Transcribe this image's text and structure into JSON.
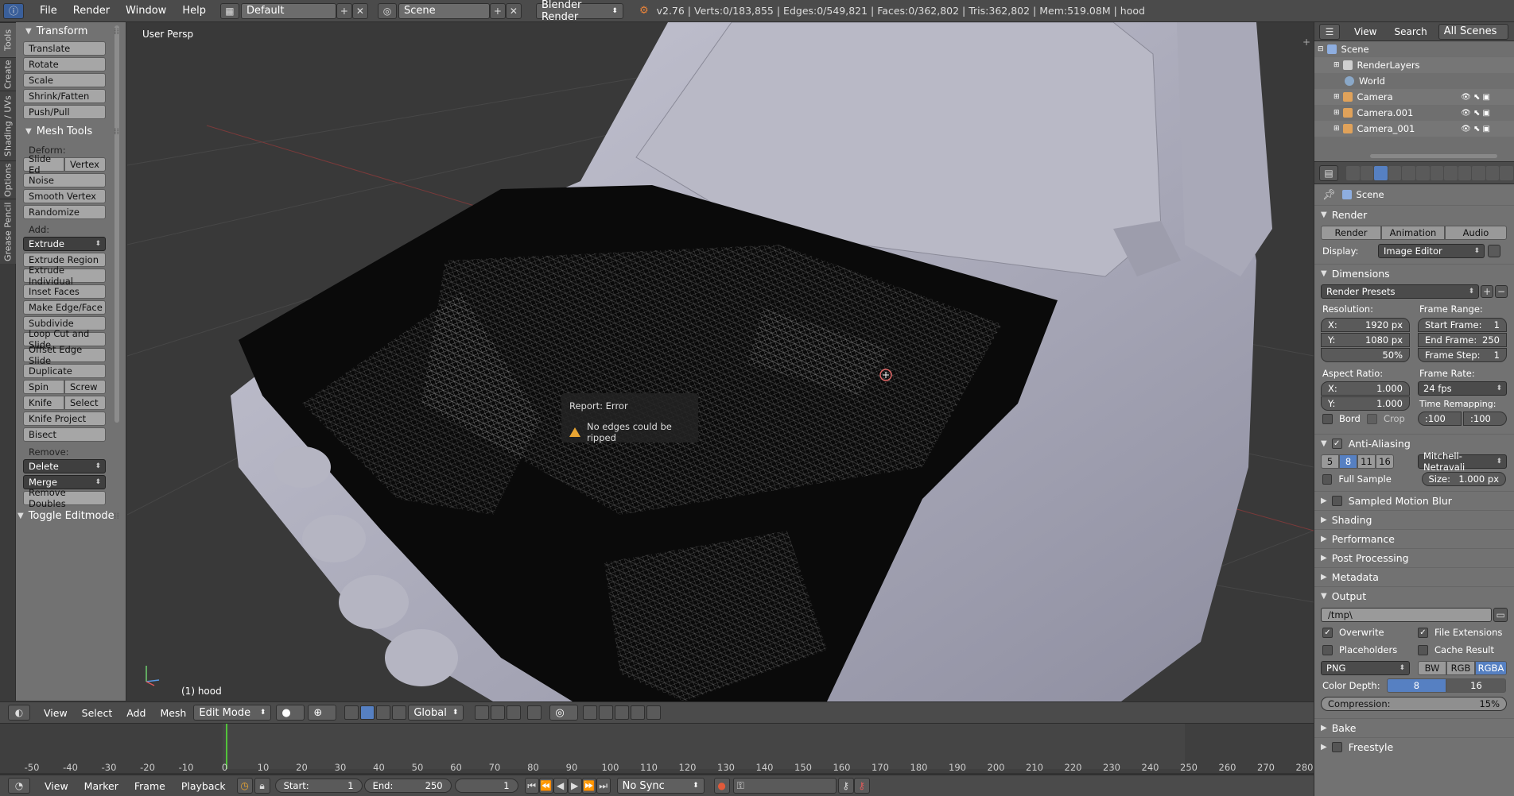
{
  "topbar": {
    "menus": [
      "File",
      "Render",
      "Window",
      "Help"
    ],
    "layout": "Default",
    "scene": "Scene",
    "engine": "Blender Render",
    "stats": "v2.76 | Verts:0/183,855 | Edges:0/549,821 | Faces:0/362,802 | Tris:362,802 | Mem:519.08M | hood"
  },
  "left_tabs": [
    "Tools",
    "Create",
    "Shading / UVs",
    "Options",
    "Grease Pencil"
  ],
  "toolshelf": {
    "transform_title": "Transform",
    "transform": [
      "Translate",
      "Rotate",
      "Scale",
      "Shrink/Fatten",
      "Push/Pull"
    ],
    "mesh_tools_title": "Mesh Tools",
    "deform_label": "Deform:",
    "slide_edge": "Slide Ed",
    "vertex": "Vertex",
    "deform": [
      "Noise",
      "Smooth Vertex",
      "Randomize"
    ],
    "add_label": "Add:",
    "extrude": "Extrude",
    "add": [
      "Extrude Region",
      "Extrude Individual",
      "Inset Faces",
      "Make Edge/Face",
      "Subdivide",
      "Loop Cut and Slide",
      "Offset Edge Slide",
      "Duplicate"
    ],
    "spin": "Spin",
    "screw": "Screw",
    "knife": "Knife",
    "select": "Select",
    "knife_project": "Knife Project",
    "bisect": "Bisect",
    "remove_label": "Remove:",
    "delete": "Delete",
    "merge": "Merge",
    "remove_doubles": "Remove Doubles",
    "toggle_editmode": "Toggle Editmode"
  },
  "viewport": {
    "view_label": "User Persp",
    "object_label": "(1) hood",
    "report_title": "Report: Error",
    "report_msg": "No edges could be ripped"
  },
  "vpheader": {
    "menus": [
      "View",
      "Select",
      "Add",
      "Mesh"
    ],
    "mode": "Edit Mode",
    "orientation": "Global"
  },
  "timeline": {
    "ticks": [
      -50,
      -40,
      -30,
      -20,
      -10,
      0,
      10,
      20,
      30,
      40,
      50,
      60,
      70,
      80,
      90,
      100,
      110,
      120,
      130,
      140,
      150,
      160,
      170,
      180,
      190,
      200,
      210,
      220,
      230,
      240,
      250,
      260,
      270,
      280
    ],
    "current_frame": 1
  },
  "bottombar": {
    "menus": [
      "View",
      "Marker",
      "Frame",
      "Playback"
    ],
    "start_label": "Start:",
    "start": "1",
    "end_label": "End:",
    "end": "250",
    "frame": "1",
    "sync": "No Sync"
  },
  "outliner": {
    "header": {
      "view": "View",
      "search": "Search",
      "scenes": "All Scenes"
    },
    "rows": [
      "Scene",
      "RenderLayers",
      "World",
      "Camera",
      "Camera.001",
      "Camera_001"
    ]
  },
  "properties": {
    "context": "Scene",
    "render_section": "Render",
    "render_btn": "Render",
    "animation_btn": "Animation",
    "audio_btn": "Audio",
    "display_label": "Display:",
    "display_value": "Image Editor",
    "dimensions": "Dimensions",
    "render_presets": "Render Presets",
    "resolution_label": "Resolution:",
    "res_x": "X:",
    "res_x_val": "1920 px",
    "res_y": "Y:",
    "res_y_val": "1080 px",
    "res_pct": "50%",
    "frame_range_label": "Frame Range:",
    "start_frame": "Start Frame:",
    "start_frame_val": "1",
    "end_frame": "End Frame:",
    "end_frame_val": "250",
    "frame_step": "Frame Step:",
    "frame_step_val": "1",
    "aspect_label": "Aspect Ratio:",
    "asp_x": "X:",
    "asp_x_val": "1.000",
    "asp_y": "Y:",
    "asp_y_val": "1.000",
    "frame_rate_label": "Frame Rate:",
    "fps": "24 fps",
    "time_remap_label": "Time Remapping:",
    "remap_old": ":100",
    "remap_new": ":100",
    "bord": "Bord",
    "crop": "Crop",
    "anti_aliasing": "Anti-Aliasing",
    "aa_samples": [
      "5",
      "8",
      "11",
      "16"
    ],
    "aa_filter": "Mitchell-Netravali",
    "full_sample": "Full Sample",
    "size_label": "Size:",
    "size_val": "1.000 px",
    "sampled_motion_blur": "Sampled Motion Blur",
    "shading": "Shading",
    "performance": "Performance",
    "post_processing": "Post Processing",
    "metadata": "Metadata",
    "output": "Output",
    "output_path": "/tmp\\",
    "overwrite": "Overwrite",
    "file_extensions": "File Extensions",
    "placeholders": "Placeholders",
    "cache_result": "Cache Result",
    "format": "PNG",
    "bw": "BW",
    "rgb": "RGB",
    "rgba": "RGBA",
    "color_depth_label": "Color Depth:",
    "depth_8": "8",
    "depth_16": "16",
    "compression_label": "Compression:",
    "compression_val": "15%",
    "bake": "Bake",
    "freestyle": "Freestyle"
  },
  "colors": {
    "accent": "#5680c2",
    "timeline_cursor": "#52c43a",
    "warning": "#e8a533"
  }
}
